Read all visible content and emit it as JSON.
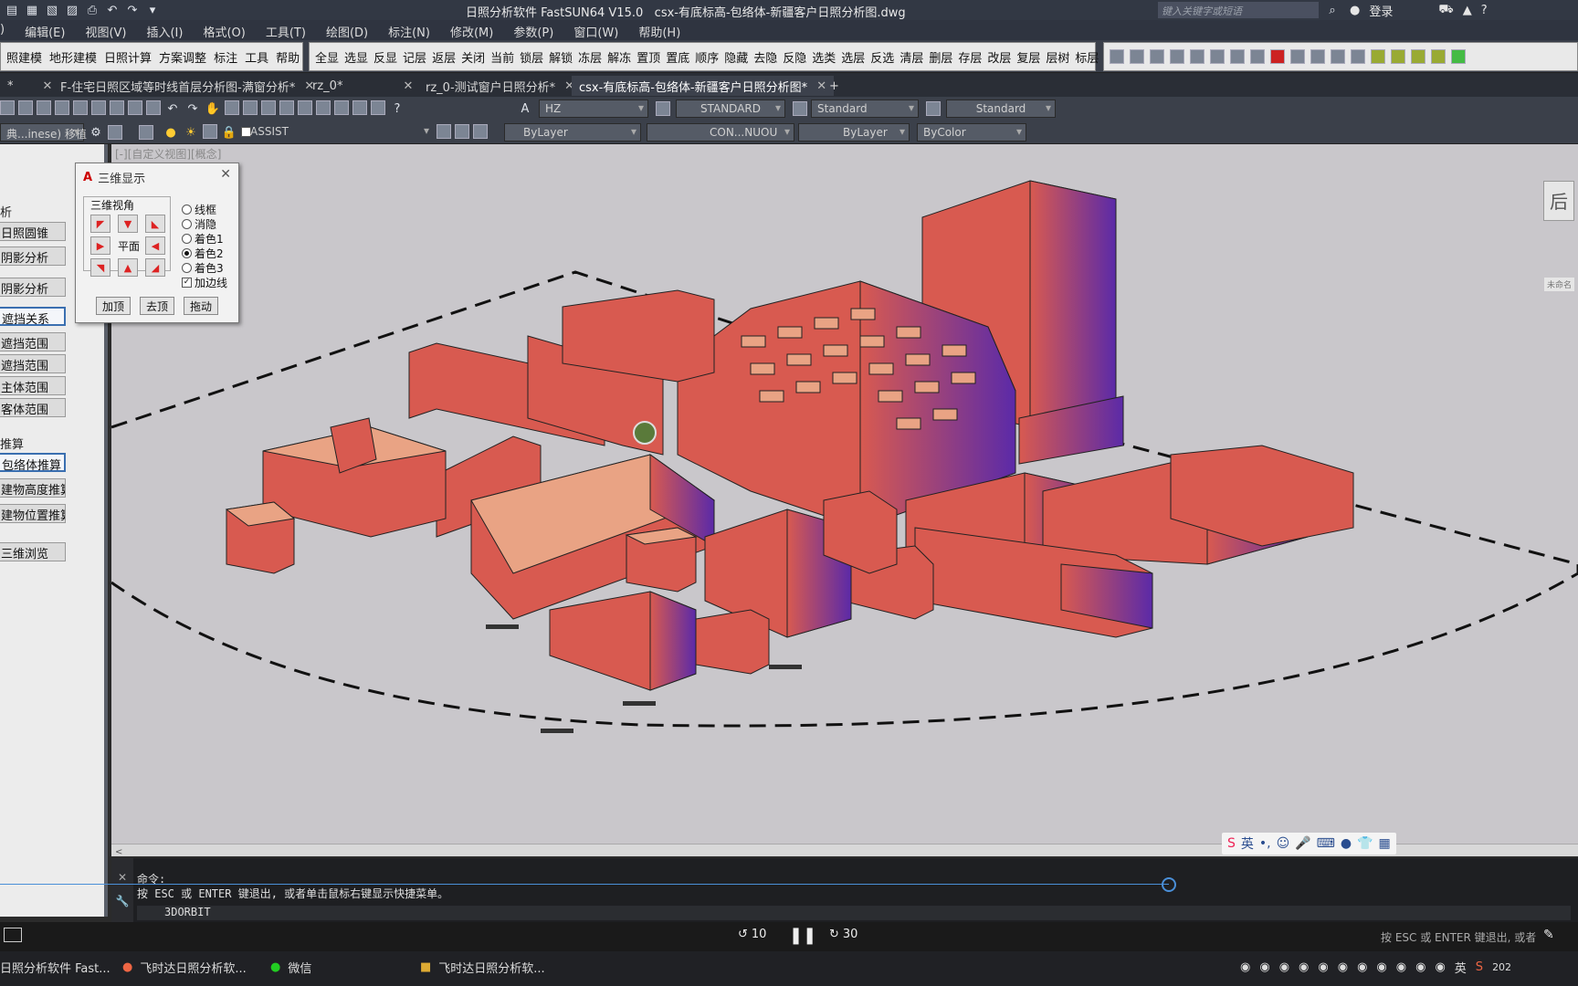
{
  "titlebar": {
    "app_title": "日照分析软件 FastSUN64 V15.0",
    "file_title": "csx-有底标高-包络体-新疆客户日照分析图.dwg",
    "search_placeholder": "键入关键字或短语",
    "login_label": "登录"
  },
  "menubar": {
    "items": [
      "编辑(E)",
      "视图(V)",
      "插入(I)",
      "格式(O)",
      "工具(T)",
      "绘图(D)",
      "标注(N)",
      "修改(M)",
      "参数(P)",
      "窗口(W)",
      "帮助(H)"
    ]
  },
  "ribbon": {
    "group1": [
      "照建模",
      "地形建模",
      "日照计算",
      "方案调整",
      "标注",
      "工具",
      "帮助"
    ],
    "group2": [
      "全显",
      "选显",
      "反显",
      "记层",
      "返层",
      "关闭",
      "当前",
      "锁层",
      "解锁",
      "冻层",
      "解冻",
      "置顶",
      "置底",
      "顺序",
      "隐藏",
      "去隐",
      "反隐",
      "选类",
      "选层",
      "反选",
      "清层",
      "删层",
      "存层",
      "改层",
      "复层",
      "层树",
      "标层"
    ]
  },
  "tabs": [
    {
      "label": "*",
      "active": false
    },
    {
      "label": "F-住宅日照区域等时线首层分析图-满窗分析*",
      "active": false
    },
    {
      "label": "rz_0*",
      "active": false
    },
    {
      "label": "rz_0-测试窗户日照分析*",
      "active": false
    },
    {
      "label": "csx-有底标高-包络体-新疆客户日照分析图*",
      "active": true
    }
  ],
  "toolbar1": {
    "textstyle": "HZ",
    "dimstyle": "STANDARD",
    "tablestyle": "Standard",
    "mleaderstyle": "Standard"
  },
  "toolbar2": {
    "workspace": "典...inese) 移植",
    "layer": "ASSIST",
    "color": "ByLayer",
    "linetype": "CON...NUOU",
    "lineweight": "ByLayer",
    "plotstyle": "ByColor"
  },
  "leftpanel": {
    "section1": "析",
    "buttons1": [
      "日照圆锥",
      "阴影分析",
      "阴影分析",
      "遮挡关系",
      "遮挡范围",
      "遮挡范围",
      "主体范围",
      "客体范围"
    ],
    "section2": "推算",
    "buttons2": [
      "包络体推算",
      "建物高度推算",
      "建物位置推算"
    ],
    "button3": "三维浏览"
  },
  "viewport": {
    "view_label": "[-][自定义视图][概念]",
    "viewcube_label": "后",
    "wcs_label": "未命名"
  },
  "dialog": {
    "title": "三维显示",
    "group_label": "三维视角",
    "center_label": "平面",
    "radios": [
      "线框",
      "消隐",
      "着色1",
      "着色2",
      "着色3"
    ],
    "selected_radio": "着色2",
    "checkbox_label": "加边线",
    "checkbox_checked": true,
    "buttons": [
      "加顶",
      "去顶",
      "拖动"
    ]
  },
  "cmdline": {
    "line1": "命令:",
    "line2": "按 ESC 或 ENTER 键退出, 或者单击鼠标右键显示快捷菜单。",
    "input": "3DORBIT"
  },
  "ime": {
    "lang": "英"
  },
  "media": {
    "rewind": "10",
    "forward": "30",
    "status_hint": "按 ESC 或 ENTER 键退出, 或者单击鼠标右..."
  },
  "taskbar": {
    "items": [
      "日照分析软件 Fast...",
      "飞时达日照分析软...",
      "微信",
      "飞时达日照分析软..."
    ],
    "lang": "英",
    "year": "202"
  },
  "colors": {
    "building_top": "#e9a384",
    "building_side": "#d85a50",
    "building_shade": "#5b2aa8",
    "accent": "#4a8fd8"
  }
}
